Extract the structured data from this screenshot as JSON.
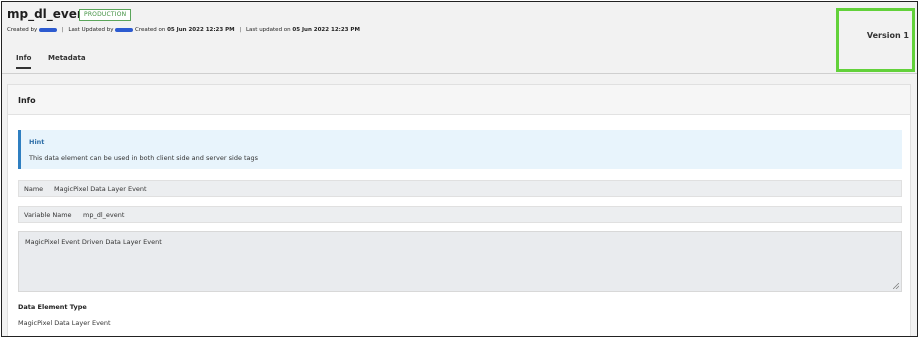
{
  "header": {
    "title": "mp_dl_event",
    "badge": "PRODUCTION",
    "created_by_label": "Created by",
    "last_updated_by_label": "Last Updated by",
    "created_on_label": "Created on",
    "created_on_value": "05 Jun 2022 12:23 PM",
    "last_updated_on_label": "Last updated on",
    "last_updated_on_value": "05 Jun 2022 12:23 PM",
    "version": "Version 1"
  },
  "tabs": [
    {
      "label": "Info",
      "active": true
    },
    {
      "label": "Metadata",
      "active": false
    }
  ],
  "info": {
    "section_title": "Info",
    "hint_title": "Hint",
    "hint_text": "This data element can be used in both client side and server side tags",
    "name_label": "Name",
    "name_value": "MagicPixel Data Layer Event",
    "variable_label": "Variable Name",
    "variable_value": "mp_dl_event",
    "description": "MagicPixel Event Driven Data Layer Event",
    "type_label": "Data Element Type",
    "type_value": "MagicPixel Data Layer Event"
  },
  "colors": {
    "highlight": "#62d13a",
    "badge": "#3f8f3f",
    "hint_accent": "#2f7fc1",
    "redaction": "#2d5bd0"
  }
}
